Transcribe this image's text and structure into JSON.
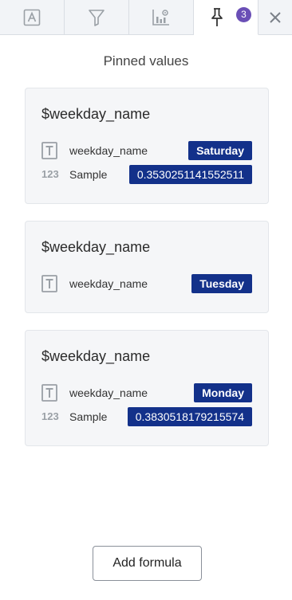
{
  "tabs": {
    "pinned_count": "3"
  },
  "panel": {
    "title": "Pinned values"
  },
  "cards": [
    {
      "title": "$weekday_name",
      "field_label": "weekday_name",
      "field_value": "Saturday",
      "sample_label": "Sample",
      "sample_value": "0.3530251141552511",
      "sample_icon_text": "123"
    },
    {
      "title": "$weekday_name",
      "field_label": "weekday_name",
      "field_value": "Tuesday"
    },
    {
      "title": "$weekday_name",
      "field_label": "weekday_name",
      "field_value": "Monday",
      "sample_label": "Sample",
      "sample_value": "0.3830518179215574",
      "sample_icon_text": "123"
    }
  ],
  "footer": {
    "add_formula_label": "Add formula"
  },
  "colors": {
    "badge_bg": "#13318a",
    "count_badge_bg": "#6a4fb6"
  }
}
